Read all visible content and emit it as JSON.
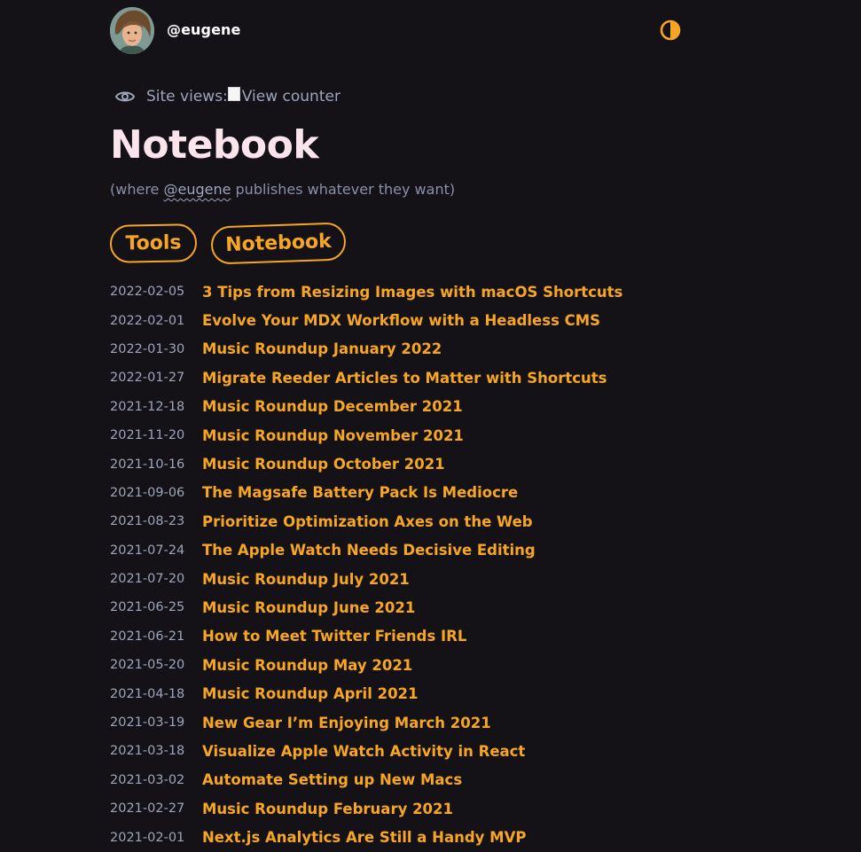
{
  "header": {
    "username": "@eugene",
    "avatar_alt": "eugene avatar"
  },
  "views": {
    "label": "Site views:",
    "counter_alt": "View counter"
  },
  "page": {
    "title": "Notebook",
    "subtitle_prefix": "(where ",
    "subtitle_handle": "@eugene",
    "subtitle_suffix": " publishes whatever they want)"
  },
  "tags": {
    "tools": "Tools",
    "notebook": "Notebook"
  },
  "posts": [
    {
      "date": "2022-02-05",
      "title": "3 Tips from Resizing Images with macOS Shortcuts"
    },
    {
      "date": "2022-02-01",
      "title": "Evolve Your MDX Workflow with a Headless CMS"
    },
    {
      "date": "2022-01-30",
      "title": "Music Roundup January 2022"
    },
    {
      "date": "2022-01-27",
      "title": "Migrate Reeder Articles to Matter with Shortcuts"
    },
    {
      "date": "2021-12-18",
      "title": "Music Roundup December 2021"
    },
    {
      "date": "2021-11-20",
      "title": "Music Roundup November 2021"
    },
    {
      "date": "2021-10-16",
      "title": "Music Roundup October 2021"
    },
    {
      "date": "2021-09-06",
      "title": "The Magsafe Battery Pack Is Mediocre"
    },
    {
      "date": "2021-08-23",
      "title": "Prioritize Optimization Axes on the Web"
    },
    {
      "date": "2021-07-24",
      "title": "The Apple Watch Needs Decisive Editing"
    },
    {
      "date": "2021-07-20",
      "title": "Music Roundup July 2021"
    },
    {
      "date": "2021-06-25",
      "title": "Music Roundup June 2021"
    },
    {
      "date": "2021-06-21",
      "title": "How to Meet Twitter Friends IRL"
    },
    {
      "date": "2021-05-20",
      "title": "Music Roundup May 2021"
    },
    {
      "date": "2021-04-18",
      "title": "Music Roundup April 2021"
    },
    {
      "date": "2021-03-19",
      "title": "New Gear I’m Enjoying March 2021"
    },
    {
      "date": "2021-03-18",
      "title": "Visualize Apple Watch Activity in React"
    },
    {
      "date": "2021-03-02",
      "title": "Automate Setting up New Macs"
    },
    {
      "date": "2021-02-27",
      "title": "Music Roundup February 2021"
    },
    {
      "date": "2021-02-01",
      "title": "Next.js Analytics Are Still a Handy MVP"
    }
  ],
  "colors": {
    "background": "#141217",
    "accent": "#f6a623",
    "title": "#fce4ec",
    "muted": "#9ea4ba"
  },
  "icons": {
    "theme_toggle": "half-circle-contrast-icon",
    "views": "eye-icon",
    "broken_image": "broken-image-icon"
  }
}
